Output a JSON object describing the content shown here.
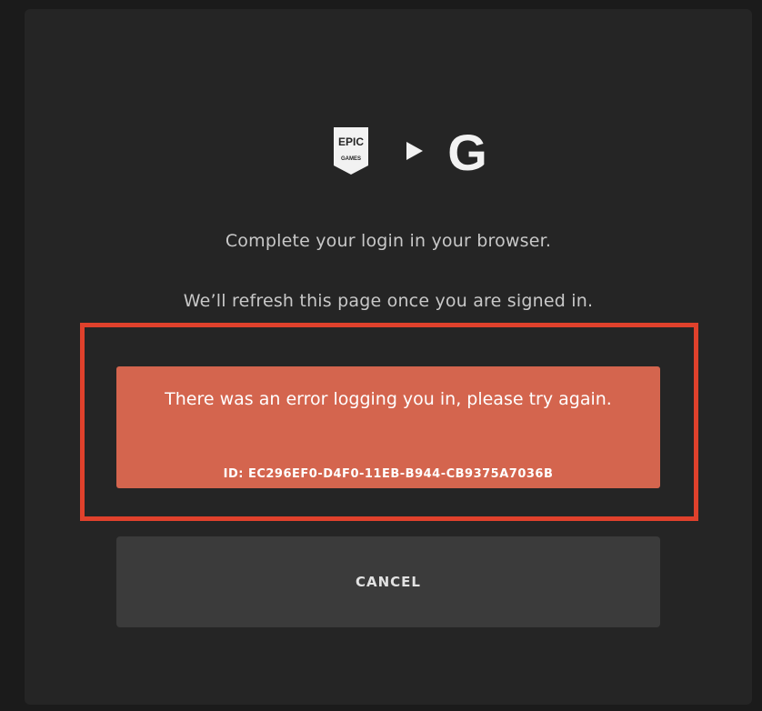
{
  "logos": {
    "epic_logo_text": "EPIC",
    "epic_logo_subtext": "GAMES",
    "google_logo_letter": "G"
  },
  "messages": {
    "line1": "Complete your login in your browser.",
    "line2": "We’ll refresh this page once you are signed in."
  },
  "error": {
    "message": "There was an error logging you in, please try again.",
    "id": "ID: EC296EF0-D4F0-11EB-B944-CB9375A7036B"
  },
  "buttons": {
    "cancel_label": "CANCEL"
  },
  "colors": {
    "dialog_bg": "#252525",
    "error_bg": "#d4654e",
    "highlight_border": "#e0412c",
    "cancel_bg": "#3b3b3b"
  },
  "icons": [
    "epic-games-logo",
    "arrow-right-icon",
    "google-logo"
  ]
}
